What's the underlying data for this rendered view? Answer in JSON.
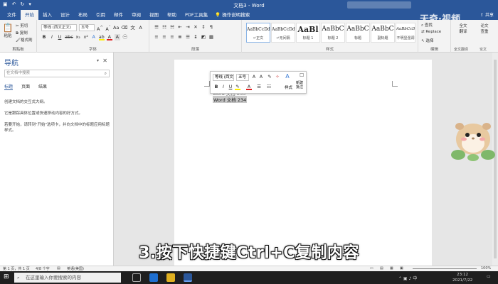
{
  "titlebar": {
    "title": "文档3 - Word",
    "share": "共享"
  },
  "tabs": [
    "文件",
    "开始",
    "插入",
    "设计",
    "布局",
    "引用",
    "邮件",
    "审阅",
    "视图",
    "帮助",
    "PDF工具集",
    "操作说明搜索"
  ],
  "ribbon": {
    "clipboard": {
      "paste": "粘贴",
      "cut": "剪切",
      "copy": "复制",
      "format_painter": "格式刷",
      "label": "剪贴板"
    },
    "font": {
      "font_name": "等线 (西文正文)",
      "font_size": "五号",
      "label": "字体"
    },
    "paragraph": {
      "label": "段落"
    },
    "styles": {
      "label": "样式",
      "items": [
        {
          "preview": "AaBbCcDd",
          "name": "↵正文"
        },
        {
          "preview": "AaBbCcDd",
          "name": "↵无间隔"
        },
        {
          "preview": "AaBl",
          "name": "标题 1"
        },
        {
          "preview": "AaBbC",
          "name": "标题 2"
        },
        {
          "preview": "AaBbC",
          "name": "标题"
        },
        {
          "preview": "AaBbC",
          "name": "副标题"
        },
        {
          "preview": "AaBbCcDd",
          "name": "不明显强调"
        }
      ]
    },
    "editing": {
      "find": "查找",
      "replace": "Replace",
      "select": "选择",
      "label": "编辑"
    },
    "translate": {
      "full": "全文",
      "full2": "翻译",
      "thesis": "论文",
      "thesis2": "查重",
      "label1": "全文翻译",
      "label2": "论文"
    }
  },
  "nav": {
    "title": "导航",
    "search_placeholder": "在文档中搜索",
    "tabs": [
      "标题",
      "页面",
      "结果"
    ],
    "p1": "创建文档的交互式大纲。",
    "p2": "它是跟踪具体位置或快速移动内容的好方式。",
    "p3": "若要开始，请转到\"开始\"选项卡，并向文档中的标题应用标题样式。"
  },
  "minitoolbar": {
    "font_name": "等线 (西文正",
    "font_size": "五号",
    "styles": "样式",
    "new_comment": "新建",
    "new_comment2": "批注"
  },
  "document": {
    "line1": "Word 文档 233",
    "line2": "Word 文档 234"
  },
  "status": {
    "page": "第 1 页，共 1 页",
    "words": "4/8 个字",
    "lang": "英语(美国)",
    "zoom": "100%"
  },
  "taskbar": {
    "search": "在这里输入你要搜索的内容",
    "time": "23:12",
    "date": "2021/7/22"
  },
  "overlay": {
    "subtitle": "3.按下快捷键Ctrl+C复制内容",
    "watermark": "天奇·视频"
  }
}
